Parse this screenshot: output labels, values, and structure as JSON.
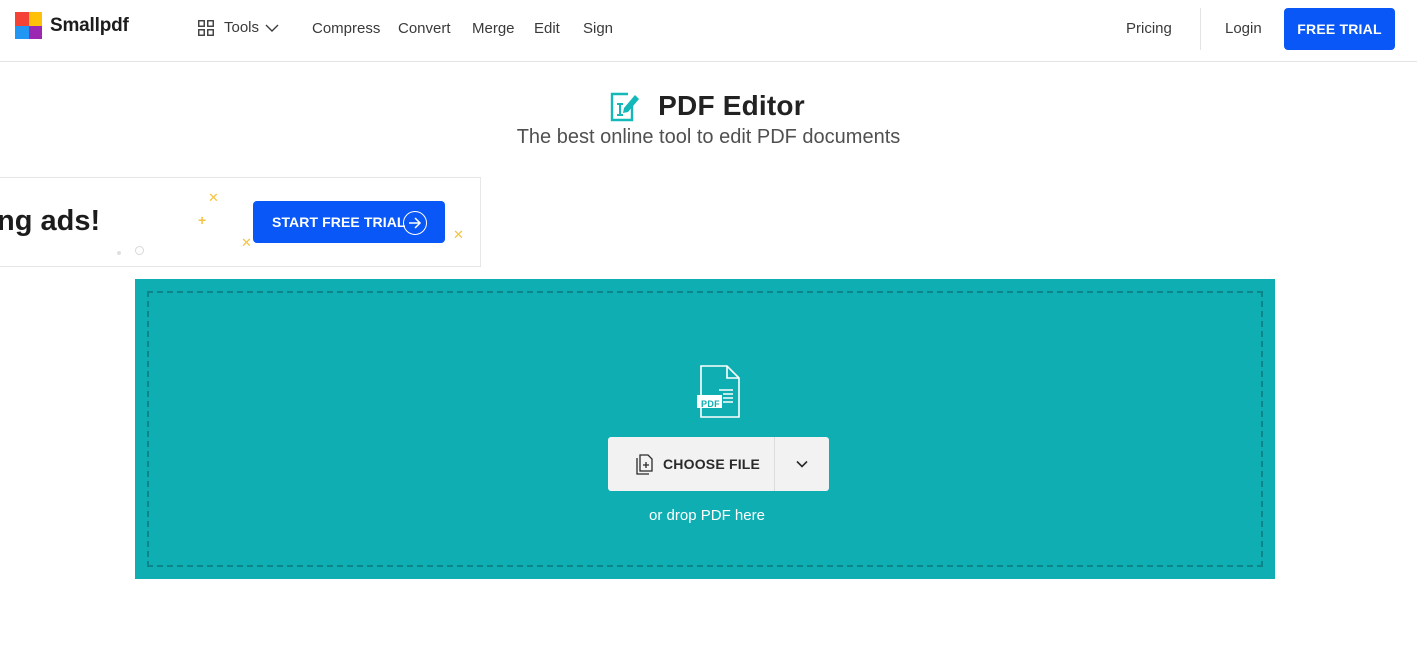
{
  "header": {
    "logo_text": "Smallpdf",
    "logo_colors": [
      "#f44336",
      "#ffc107",
      "#2196f3",
      "#9c27b0"
    ],
    "tools_label": "Tools",
    "nav": [
      {
        "label": "Compress"
      },
      {
        "label": "Convert"
      },
      {
        "label": "Merge"
      },
      {
        "label": "Edit"
      },
      {
        "label": "Sign"
      }
    ],
    "pricing_label": "Pricing",
    "login_label": "Login",
    "free_trial_label": "FREE TRIAL"
  },
  "page": {
    "title": "PDF Editor",
    "subtitle": "The best online tool to edit PDF documents"
  },
  "ad": {
    "partial_text": "ng ads!",
    "button_label": "START FREE TRIAL"
  },
  "dropzone": {
    "icon_badge": "PDF",
    "choose_label": "CHOOSE FILE",
    "hint": "or drop PDF here"
  },
  "colors": {
    "accent_blue": "#0957f6",
    "dropzone_teal": "#0eaeb2",
    "title_icon_teal": "#14b8b8"
  }
}
